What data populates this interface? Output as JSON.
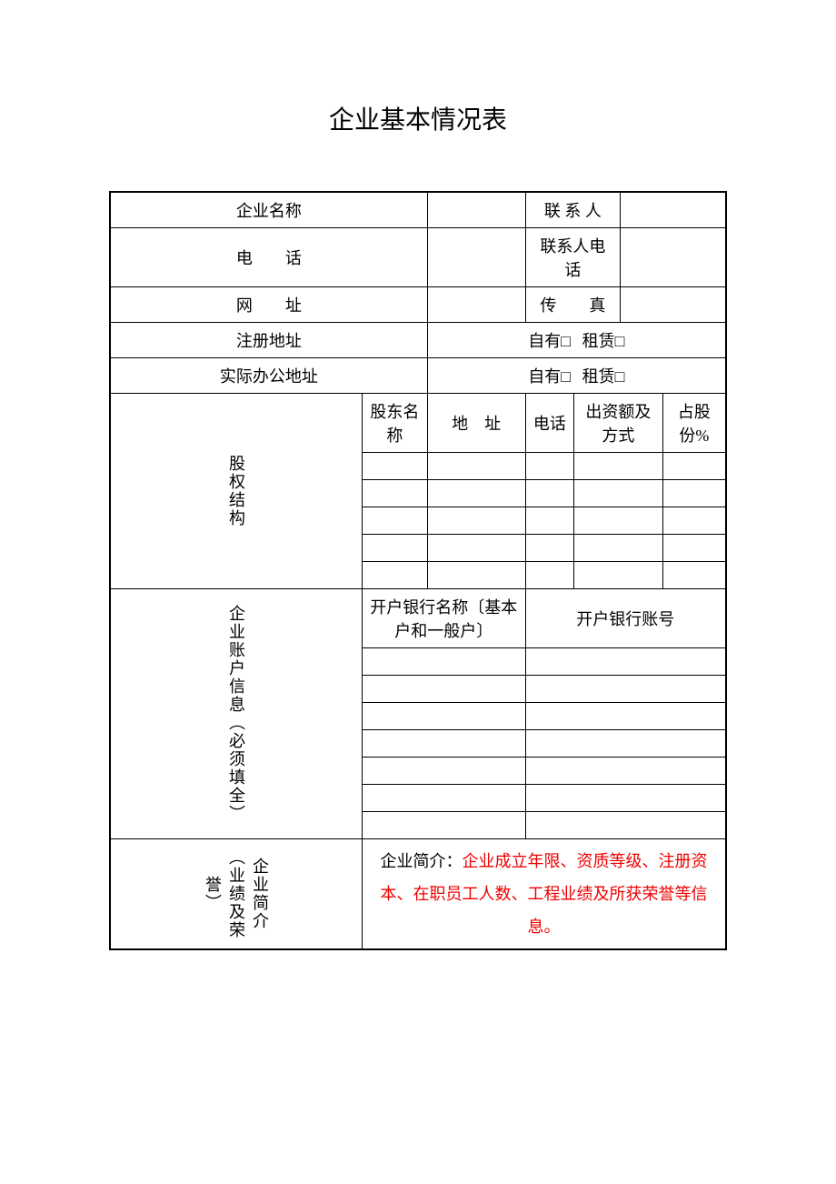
{
  "title": "企业基本情况表",
  "row1": {
    "label1": "企业名称",
    "value1": "",
    "label2": "联 系 人",
    "value2": ""
  },
  "row2": {
    "label1": "电　　话",
    "value1": "",
    "label2": "联系人电话",
    "value2": ""
  },
  "row3": {
    "label1": "网　　址",
    "value1": "",
    "label2": "传　　真",
    "value2": ""
  },
  "row4": {
    "label": "注册地址",
    "value": "",
    "opt1": "自有□",
    "opt2": "租赁□"
  },
  "row5": {
    "label": "实际办公地址",
    "value": "",
    "opt1": "自有□",
    "opt2": "租赁□"
  },
  "shareholders": {
    "section_label": "股权结构",
    "headers": {
      "name": "股东名称",
      "addr": "地　址",
      "phone": "电话",
      "invest": "出资额及方式",
      "pct": "占股份%"
    },
    "rows": [
      {
        "name": "",
        "addr": "",
        "phone": "",
        "invest": "",
        "pct": ""
      },
      {
        "name": "",
        "addr": "",
        "phone": "",
        "invest": "",
        "pct": ""
      },
      {
        "name": "",
        "addr": "",
        "phone": "",
        "invest": "",
        "pct": ""
      },
      {
        "name": "",
        "addr": "",
        "phone": "",
        "invest": "",
        "pct": ""
      },
      {
        "name": "",
        "addr": "",
        "phone": "",
        "invest": "",
        "pct": ""
      }
    ]
  },
  "bank": {
    "section_label": "企业账户信息︵必须填全︶",
    "header1": "开户银行名称〔基本户和一般户〕",
    "header2": "开户银行账号",
    "rows": [
      {
        "name": "",
        "acct": ""
      },
      {
        "name": "",
        "acct": ""
      },
      {
        "name": "",
        "acct": ""
      },
      {
        "name": "",
        "acct": ""
      },
      {
        "name": "",
        "acct": ""
      },
      {
        "name": "",
        "acct": ""
      },
      {
        "name": "",
        "acct": ""
      }
    ]
  },
  "intro": {
    "section_label": "企业简介︵业绩及荣誉︶",
    "prefix": "企业简介：",
    "content": "企业成立年限、资质等级、注册资本、在职员工人数、工程业绩及所获荣誉等信息。"
  }
}
